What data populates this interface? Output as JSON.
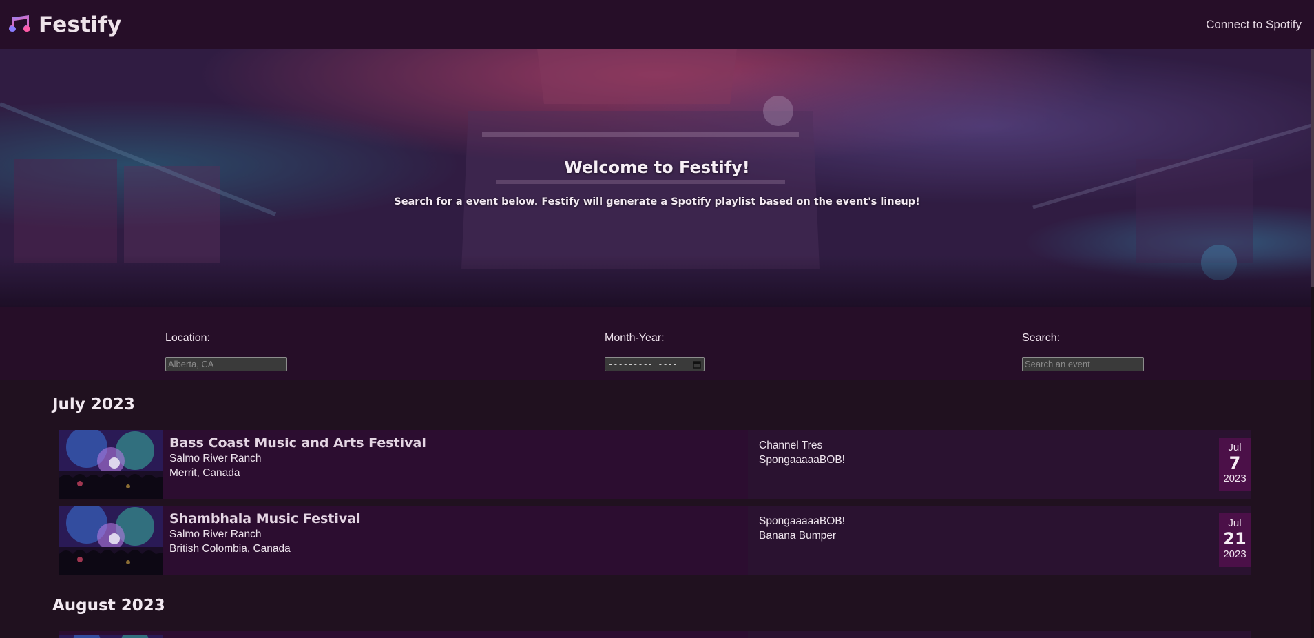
{
  "header": {
    "brand": "Festify",
    "connect_label": "Connect to Spotify"
  },
  "hero": {
    "title": "Welcome to Festify!",
    "subtitle": "Search for a event below. Festify will generate a Spotify playlist based on the event's lineup!"
  },
  "filters": {
    "location": {
      "label": "Location:",
      "placeholder": "Alberta, CA"
    },
    "month_year": {
      "label": "Month-Year:",
      "value": "--------- ----"
    },
    "search": {
      "label": "Search:",
      "placeholder": "Search an event"
    }
  },
  "months": [
    {
      "heading": "July 2023",
      "events": [
        {
          "name": "Bass Coast Music and Arts Festival",
          "venue": "Salmo River Ranch",
          "city": "Merrit, Canada",
          "lineup": [
            "Channel Tres",
            "SpongaaaaaBOB!"
          ],
          "date": {
            "month": "Jul",
            "day": "7",
            "year": "2023"
          }
        },
        {
          "name": "Shambhala Music Festival",
          "venue": "Salmo River Ranch",
          "city": "British Colombia, Canada",
          "lineup": [
            "SpongaaaaaBOB!",
            "Banana Bumper"
          ],
          "date": {
            "month": "Jul",
            "day": "21",
            "year": "2023"
          }
        }
      ]
    },
    {
      "heading": "August 2023",
      "events": []
    }
  ],
  "colors": {
    "header_bg": "#260e28",
    "page_bg": "#20111f",
    "card_bg": "#2c0d30",
    "badge_bg": "#4b1048"
  }
}
